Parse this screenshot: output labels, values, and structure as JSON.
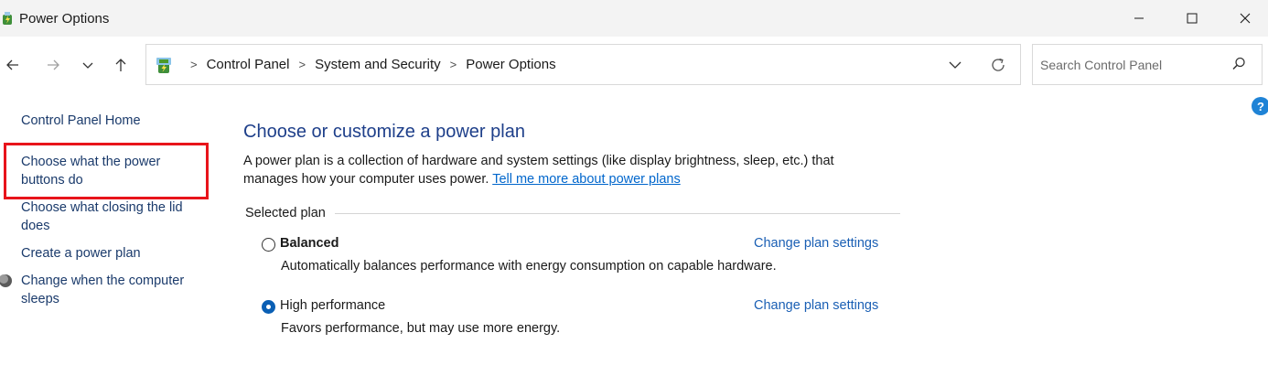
{
  "window": {
    "title": "Power Options",
    "minimize_icon": "minimize-icon",
    "maximize_icon": "maximize-icon",
    "close_icon": "close-icon"
  },
  "nav": {
    "back_icon": "arrow-left-icon",
    "forward_icon": "arrow-right-icon",
    "recent_icon": "chevron-down-icon",
    "up_icon": "arrow-up-icon"
  },
  "address": {
    "icon": "control-panel-icon",
    "breadcrumbs": [
      "Control Panel",
      "System and Security",
      "Power Options"
    ],
    "separator": ">"
  },
  "search": {
    "placeholder": "Search Control Panel",
    "value": ""
  },
  "help": {
    "label": "?"
  },
  "sidebar": {
    "home": "Control Panel Home",
    "items": [
      {
        "label": "Choose what the power buttons do",
        "highlighted": true
      },
      {
        "label": "Choose what closing the lid does"
      },
      {
        "label": "Create a power plan"
      },
      {
        "label": "Change when the computer sleeps",
        "icon": "moon-icon"
      }
    ],
    "highlight_color": "#e8141b"
  },
  "main": {
    "title": "Choose or customize a power plan",
    "description": "A power plan is a collection of hardware and system settings (like display brightness, sleep, etc.) that manages how your computer uses power.",
    "description_link": "Tell me more about power plans",
    "group_label": "Selected plan",
    "plans": [
      {
        "name": "Balanced",
        "selected": false,
        "link": "Change plan settings",
        "description": "Automatically balances performance with energy consumption on capable hardware."
      },
      {
        "name": "High performance",
        "selected": true,
        "link": "Change plan settings",
        "description": "Favors performance, but may use more energy."
      }
    ]
  },
  "colors": {
    "title_blue": "#1e3f8a",
    "link_blue": "#0066cc",
    "sidebar_link": "#1a3a6b",
    "radio_selected": "#0a5fb4"
  }
}
